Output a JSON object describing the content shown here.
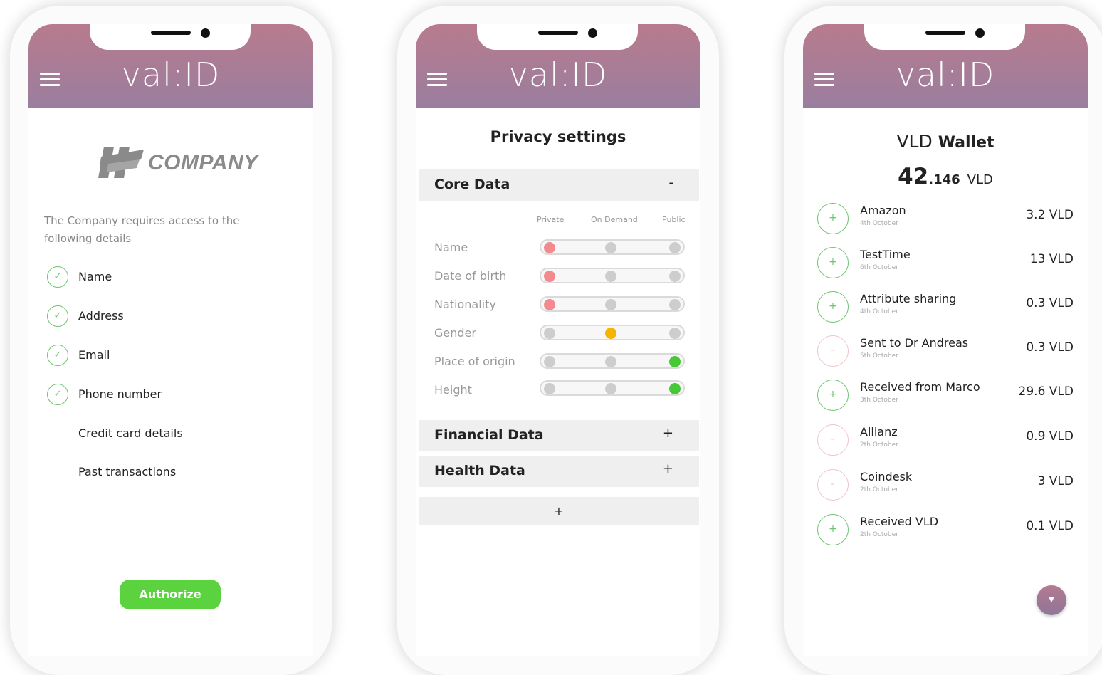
{
  "brand": "val:ID",
  "screen1": {
    "company_name": "COMPANY",
    "request_text": "The Company requires access to the following details",
    "details": [
      {
        "label": "Name",
        "checked": true
      },
      {
        "label": "Address",
        "checked": true
      },
      {
        "label": "Email",
        "checked": true
      },
      {
        "label": "Phone number",
        "checked": true
      },
      {
        "label": "Credit card details",
        "checked": false
      },
      {
        "label": "Past transactions",
        "checked": false
      }
    ],
    "authorize_label": "Authorize",
    "colors": {
      "accent": "#5bd33f",
      "check": "#6ec46e"
    }
  },
  "screen2": {
    "title": "Privacy settings",
    "core_section": {
      "label": "Core Data",
      "toggle": "-"
    },
    "columns": [
      "Private",
      "On Demand",
      "Public"
    ],
    "fields": [
      {
        "label": "Name",
        "setting": "Private"
      },
      {
        "label": "Date of birth",
        "setting": "Private"
      },
      {
        "label": "Nationality",
        "setting": "Private"
      },
      {
        "label": "Gender",
        "setting": "On Demand"
      },
      {
        "label": "Place of origin",
        "setting": "Public"
      },
      {
        "label": "Height",
        "setting": "Public"
      }
    ],
    "financial_section": {
      "label": "Financial Data",
      "toggle": "+"
    },
    "health_section": {
      "label": "Health Data",
      "toggle": "+"
    },
    "add_label": "+",
    "colors": {
      "private": "#f28a8f",
      "on_demand": "#f4b400",
      "public": "#46c837"
    }
  },
  "screen3": {
    "title_light": "VLD",
    "title_bold": "Wallet",
    "balance_int": "42",
    "balance_dec": ".146",
    "balance_unit": "VLD",
    "transactions": [
      {
        "name": "Amazon",
        "date": "4th October",
        "amount": "3.2 VLD",
        "direction": "+"
      },
      {
        "name": "TestTime",
        "date": "6th October",
        "amount": "13 VLD",
        "direction": "+"
      },
      {
        "name": "Attribute sharing",
        "date": "4th October",
        "amount": "0.3 VLD",
        "direction": "+"
      },
      {
        "name": "Sent to Dr Andreas",
        "date": "5th October",
        "amount": "0.3 VLD",
        "direction": "-"
      },
      {
        "name": "Received from Marco",
        "date": "3th October",
        "amount": "29.6 VLD",
        "direction": "+"
      },
      {
        "name": "Allianz",
        "date": "2th October",
        "amount": "0.9 VLD",
        "direction": "-"
      },
      {
        "name": "Coindesk",
        "date": "2th October",
        "amount": "3 VLD",
        "direction": "-"
      },
      {
        "name": "Received VLD",
        "date": "2th October",
        "amount": "0.1 VLD",
        "direction": "+"
      }
    ],
    "fab_icon": "chevron-down-icon"
  },
  "colors": {
    "header_top": "#b87b8d",
    "header_bottom": "#9a7e9f"
  }
}
